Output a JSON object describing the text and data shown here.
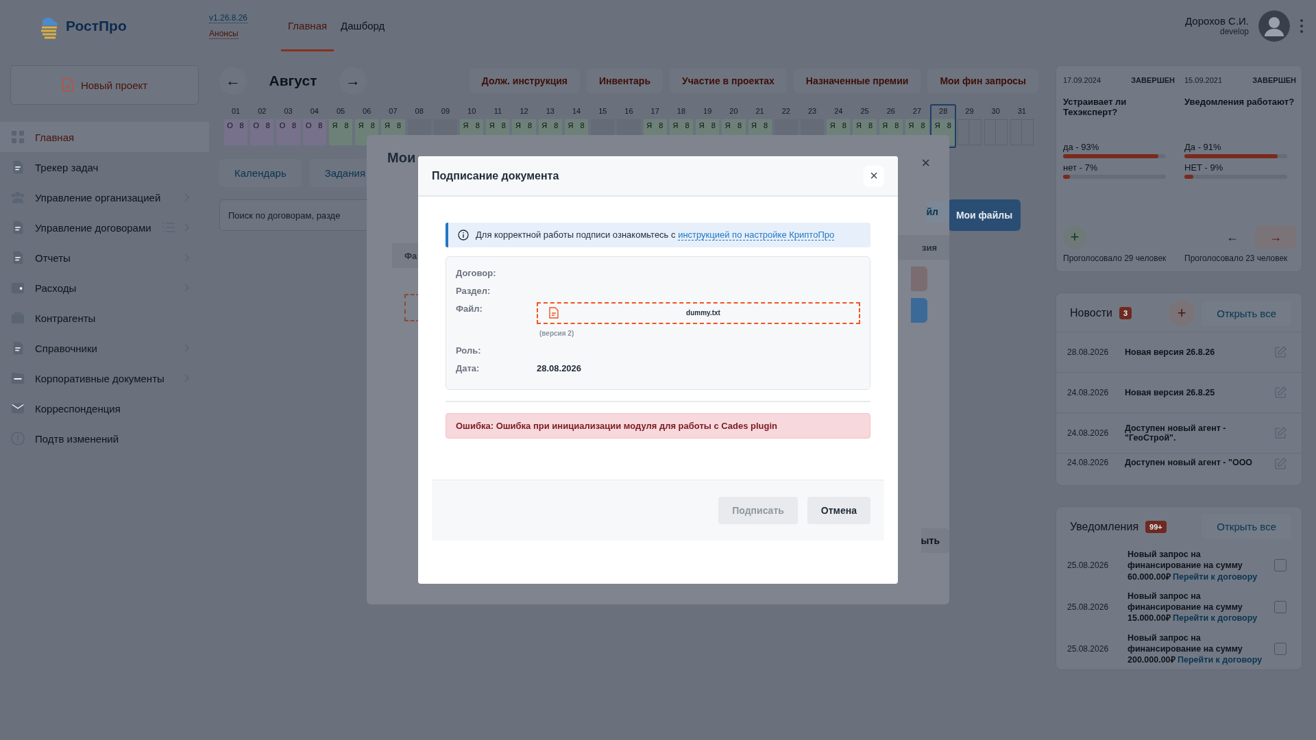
{
  "header": {
    "logo": "РостПро",
    "version": "v1.26.8.26",
    "announcements": "Анонсы",
    "tabs": [
      {
        "label": "Главная",
        "selected": true
      },
      {
        "label": "Дашборд",
        "selected": false
      }
    ],
    "user": {
      "name": "Дорохов С.И.",
      "role": "develop"
    }
  },
  "sidebar": {
    "new_project": "Новый проект",
    "items": [
      {
        "label": "Главная",
        "selected": true,
        "expandable": false,
        "list_view": false
      },
      {
        "label": "Трекер задач",
        "selected": false,
        "expandable": false,
        "list_view": false
      },
      {
        "label": "Управление организацией",
        "selected": false,
        "expandable": true,
        "list_view": false
      },
      {
        "label": "Управление договорами",
        "selected": false,
        "expandable": true,
        "list_view": true
      },
      {
        "label": "Отчеты",
        "selected": false,
        "expandable": true,
        "list_view": false
      },
      {
        "label": "Расходы",
        "selected": false,
        "expandable": true,
        "list_view": false
      },
      {
        "label": "Контрагенты",
        "selected": false,
        "expandable": false,
        "list_view": false
      },
      {
        "label": "Справочники",
        "selected": false,
        "expandable": true,
        "list_view": false
      },
      {
        "label": "Корпоративные документы",
        "selected": false,
        "expandable": true,
        "list_view": false
      },
      {
        "label": "Корреспонденция",
        "selected": false,
        "expandable": false,
        "list_view": false
      },
      {
        "label": "Подтв изменений",
        "selected": false,
        "expandable": false,
        "list_view": false
      }
    ]
  },
  "month_nav": {
    "prev": "←",
    "month": "Август",
    "next": "→"
  },
  "quick_links": [
    "Долж. инструкция",
    "Инвентарь",
    "Участие в проектах",
    "Назначенные премии",
    "Мои фин запросы"
  ],
  "calendar": {
    "days": [
      {
        "day": "01",
        "kind": "absence",
        "mark": "О",
        "hours": "8",
        "selected": false
      },
      {
        "day": "02",
        "kind": "absence",
        "mark": "О",
        "hours": "8",
        "selected": false
      },
      {
        "day": "03",
        "kind": "absence",
        "mark": "О",
        "hours": "8",
        "selected": false
      },
      {
        "day": "04",
        "kind": "absence",
        "mark": "О",
        "hours": "8",
        "selected": false
      },
      {
        "day": "05",
        "kind": "present",
        "mark": "Я",
        "hours": "8",
        "selected": false
      },
      {
        "day": "06",
        "kind": "present",
        "mark": "Я",
        "hours": "8",
        "selected": false
      },
      {
        "day": "07",
        "kind": "present",
        "mark": "Я",
        "hours": "8",
        "selected": false
      },
      {
        "day": "08",
        "kind": "weekend",
        "selected": false
      },
      {
        "day": "09",
        "kind": "weekend",
        "selected": false
      },
      {
        "day": "10",
        "kind": "present",
        "mark": "Я",
        "hours": "8",
        "selected": false
      },
      {
        "day": "11",
        "kind": "present",
        "mark": "Я",
        "hours": "8",
        "selected": false
      },
      {
        "day": "12",
        "kind": "present",
        "mark": "Я",
        "hours": "8",
        "selected": false
      },
      {
        "day": "13",
        "kind": "present",
        "mark": "Я",
        "hours": "8",
        "selected": false
      },
      {
        "day": "14",
        "kind": "present",
        "mark": "Я",
        "hours": "8",
        "selected": false
      },
      {
        "day": "15",
        "kind": "weekend",
        "selected": false
      },
      {
        "day": "16",
        "kind": "weekend",
        "selected": false
      },
      {
        "day": "17",
        "kind": "present",
        "mark": "Я",
        "hours": "8",
        "selected": false
      },
      {
        "day": "18",
        "kind": "present",
        "mark": "Я",
        "hours": "8",
        "selected": false
      },
      {
        "day": "19",
        "kind": "present",
        "mark": "Я",
        "hours": "8",
        "selected": false
      },
      {
        "day": "20",
        "kind": "present",
        "mark": "Я",
        "hours": "8",
        "selected": false
      },
      {
        "day": "21",
        "kind": "present",
        "mark": "Я",
        "hours": "8",
        "selected": false
      },
      {
        "day": "22",
        "kind": "weekend",
        "selected": false
      },
      {
        "day": "23",
        "kind": "weekend",
        "selected": false
      },
      {
        "day": "24",
        "kind": "present",
        "mark": "Я",
        "hours": "8",
        "selected": false
      },
      {
        "day": "25",
        "kind": "present",
        "mark": "Я",
        "hours": "8",
        "selected": false
      },
      {
        "day": "26",
        "kind": "present",
        "mark": "Я",
        "hours": "8",
        "selected": false
      },
      {
        "day": "27",
        "kind": "present",
        "mark": "Я",
        "hours": "8",
        "selected": false
      },
      {
        "day": "28",
        "kind": "present",
        "mark": "Я",
        "hours": "8",
        "selected": true
      },
      {
        "day": "29",
        "kind": "future",
        "selected": false
      },
      {
        "day": "30",
        "kind": "future",
        "selected": false
      },
      {
        "day": "31",
        "kind": "future",
        "selected": false
      }
    ]
  },
  "view_tabs": [
    "Календарь",
    "Задания"
  ],
  "search": {
    "placeholder": "Поиск по договорам, разде"
  },
  "files_button": "Мои файлы",
  "back_dialog": {
    "title": "Мои",
    "close": "×",
    "left_header": "Фа",
    "right_button": "йл",
    "right_header": "зия",
    "footer_button": "ыть"
  },
  "polls": [
    {
      "date": "17.09.2024",
      "status": "ЗАВЕРШЕН",
      "question": "Устраивает ли Техэксперт?",
      "kind": "add",
      "add": "+",
      "options": [
        {
          "label": "да - 93%",
          "level": 0.93
        },
        {
          "label": "нет - 7%",
          "level": 0.07
        }
      ],
      "votes": "Проголосовало 29 человек"
    },
    {
      "date": "15.09.2021",
      "status": "ЗАВЕРШЕН",
      "question": "Уведомления работают?",
      "kind": "nav",
      "prev": "←",
      "next": "→",
      "options": [
        {
          "label": "Да - 91%",
          "level": 0.91
        },
        {
          "label": "НЕТ - 9%",
          "level": 0.09
        }
      ],
      "votes": "Проголосовало 23 человек"
    }
  ],
  "news": {
    "title": "Новости",
    "count": "3",
    "add": "+",
    "open_all": "Открыть все",
    "items": [
      {
        "date": "28.08.2026",
        "title": "Новая версия 26.8.26"
      },
      {
        "date": "24.08.2026",
        "title": "Новая версия 26.8.25"
      },
      {
        "date": "24.08.2026",
        "title": "Доступен новый агент - \"ГеоСтрой\"."
      },
      {
        "date": "24.08.2026",
        "title": "Доступен новый агент - \"ООО"
      }
    ]
  },
  "notifications": {
    "title": "Уведомления",
    "count": "99+",
    "open_all": "Открыть все",
    "items": [
      {
        "date": "25.08.2026",
        "text": "Новый запрос на финансирование на сумму 60.000.00₽",
        "link": "Перейти к договору",
        "checked": false
      },
      {
        "date": "25.08.2026",
        "text": "Новый запрос на финансирование на сумму 15.000.00₽",
        "link": "Перейти к договору",
        "checked": false
      },
      {
        "date": "25.08.2026",
        "text": "Новый запрос на финансирование на сумму 200.000.00₽",
        "link": "Перейти к договору",
        "checked": false
      }
    ]
  },
  "dialog": {
    "title": "Подписание документа",
    "close": "×",
    "info": {
      "text": "Для корректной работы подписи ознакомьтесь с",
      "link": "инструкцией по настройке КриптоПро"
    },
    "fields": [
      {
        "kind": "text",
        "label": "Договор:"
      },
      {
        "kind": "text",
        "label": "Раздел:"
      },
      {
        "kind": "file",
        "label": "Файл:",
        "file": "dummy.txt",
        "note": "(версия 2)"
      },
      {
        "kind": "text",
        "label": "Роль:"
      },
      {
        "kind": "text",
        "label": "Дата:",
        "value": "28.08.2026"
      }
    ],
    "error": "Ошибка: Ошибка при инициализации модуля для работы с Cades plugin",
    "buttons": [
      {
        "label": "Подписать",
        "disabled": true
      },
      {
        "label": "Отмена",
        "disabled": false
      }
    ]
  }
}
